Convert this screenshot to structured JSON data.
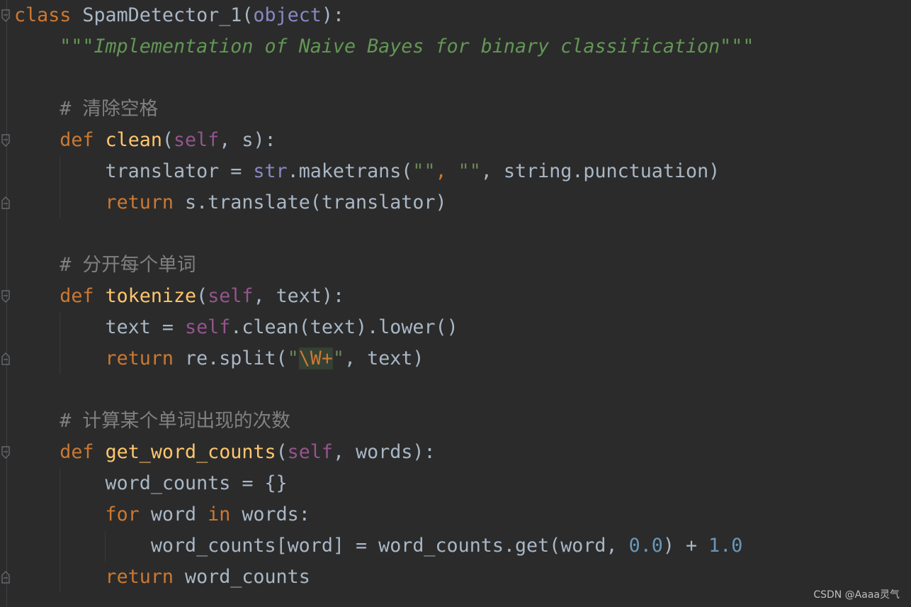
{
  "code": {
    "l1": {
      "kw": "class",
      "name": " SpamDetector_1(",
      "base": "object",
      "end": "):"
    },
    "l2": {
      "indent": "    ",
      "doc": "\"\"\"Implementation of Naive Bayes for binary classification\"\"\""
    },
    "l4": {
      "indent": "    ",
      "comment": "# 清除空格"
    },
    "l5": {
      "indent": "    ",
      "kw": "def",
      "sp": " ",
      "fn": "clean",
      "p1": "(",
      "self": "self",
      "p2": ", s):"
    },
    "l6": {
      "indent": "        ",
      "a": "translator = ",
      "builtin": "str",
      "b": ".maketrans(",
      "s1": "\"\"",
      "c": ", ",
      "s2": "\"\"",
      "d": ", string.punctuation)"
    },
    "l7": {
      "indent": "        ",
      "kw": "return",
      "rest": " s.translate(translator)"
    },
    "l9": {
      "indent": "    ",
      "comment": "# 分开每个单词"
    },
    "l10": {
      "indent": "    ",
      "kw": "def",
      "sp": " ",
      "fn": "tokenize",
      "p1": "(",
      "self": "self",
      "p2": ", text):"
    },
    "l11": {
      "indent": "        ",
      "a": "text = ",
      "self": "self",
      "b": ".clean(text).lower()"
    },
    "l12": {
      "indent": "        ",
      "kw": "return",
      "a": " re.split(",
      "q1": "\"",
      "esc": "\\W+",
      "q2": "\"",
      "b": ", text)"
    },
    "l14": {
      "indent": "    ",
      "comment": "# 计算某个单词出现的次数"
    },
    "l15": {
      "indent": "    ",
      "kw": "def",
      "sp": " ",
      "fn": "get_word_counts",
      "p1": "(",
      "self": "self",
      "p2": ", words):"
    },
    "l16": {
      "indent": "        ",
      "a": "word_counts = {}"
    },
    "l17": {
      "indent": "        ",
      "kw1": "for",
      "a": " word ",
      "kw2": "in",
      "b": " words:"
    },
    "l18": {
      "indent": "            ",
      "a": "word_counts[word] = word_counts.get(word, ",
      "n1": "0.0",
      "b": ") + ",
      "n2": "1.0"
    },
    "l19": {
      "indent": "        ",
      "kw": "return",
      "rest": " word_counts"
    }
  },
  "watermark": "CSDN @Aaaa灵气",
  "colors": {
    "background": "#2b2b2b",
    "keyword": "#cc7832",
    "function": "#ffc66d",
    "self": "#94558d",
    "string": "#6a8759",
    "comment": "#808080",
    "number": "#6897bb",
    "text": "#a9b7c6"
  }
}
